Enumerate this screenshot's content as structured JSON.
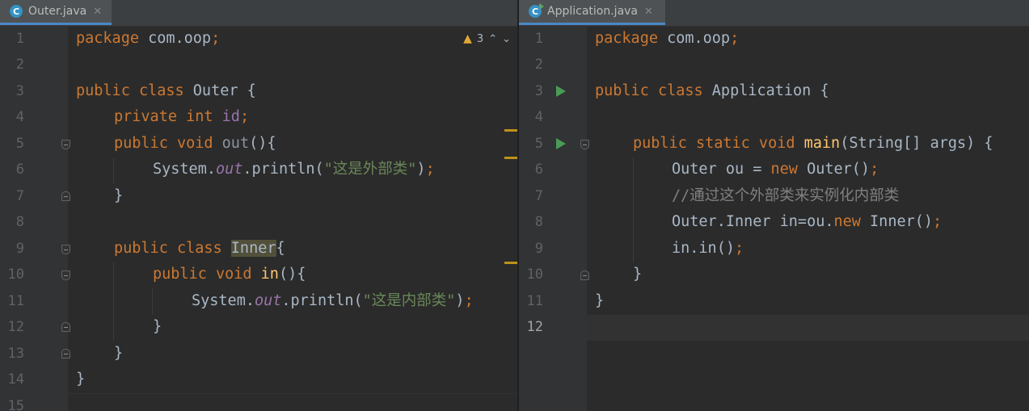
{
  "left_editor": {
    "tab": {
      "icon": "class-icon",
      "icon_letter": "C",
      "label": "Outer.java",
      "close": "✕"
    },
    "warnings": {
      "icon": "warning-icon",
      "count": "3",
      "prev": "⌃",
      "next": "⌄"
    },
    "line_numbers": [
      "1",
      "2",
      "3",
      "4",
      "5",
      "6",
      "7",
      "8",
      "9",
      "10",
      "11",
      "12",
      "13",
      "14",
      "15"
    ],
    "code": {
      "l1": {
        "kw": "package",
        "rest": " com.oop",
        "semi": ";"
      },
      "l3": {
        "kw": "public class",
        "rest": " Outer {"
      },
      "l4": {
        "kw": "private int",
        "field": "id",
        "semi": ";"
      },
      "l5": {
        "kw": "public void",
        "name": "out",
        "rest": "(){"
      },
      "l6": {
        "a": "System.",
        "it": "out",
        "b": ".println(",
        "str": "\"这是外部类\"",
        "c": ")",
        "semi": ";"
      },
      "l7": {
        "rest": "}"
      },
      "l9": {
        "kw": "public class",
        "name": "Inner",
        "rest": "{"
      },
      "l10": {
        "kw": "public void",
        "name": "in",
        "rest": "(){"
      },
      "l11": {
        "a": "System.",
        "it": "out",
        "b": ".println(",
        "str": "\"这是内部类\"",
        "c": ")",
        "semi": ";"
      },
      "l12": {
        "rest": "}"
      },
      "l13": {
        "rest": "}"
      },
      "l14": {
        "rest": "}"
      }
    }
  },
  "right_editor": {
    "tab": {
      "icon": "runnable-class-icon",
      "icon_letter": "C",
      "label": "Application.java",
      "close": "✕"
    },
    "line_numbers": [
      "1",
      "2",
      "3",
      "4",
      "5",
      "6",
      "7",
      "8",
      "9",
      "10",
      "11",
      "12"
    ],
    "code": {
      "l1": {
        "kw": "package",
        "rest": " com.oop",
        "semi": ";"
      },
      "l3": {
        "kw": "public class",
        "rest": " Application {"
      },
      "l5": {
        "kw": "public static void",
        "name": "main",
        "rest": "(String[] args) {"
      },
      "l6": {
        "a": "Outer ou = ",
        "kw": "new",
        "b": " Outer()",
        "semi": ";"
      },
      "l7": {
        "comment": "//通过这个外部类来实例化内部类"
      },
      "l8": {
        "a": "Outer.Inner in=ou.",
        "kw": "new",
        "b": " Inner()",
        "semi": ";"
      },
      "l9": {
        "a": "in.in()",
        "semi": ";"
      },
      "l10": {
        "rest": "}"
      },
      "l11": {
        "rest": "}"
      }
    }
  },
  "colors": {
    "keyword": "#cc7832",
    "field": "#9876aa",
    "method": "#ffc66d",
    "string": "#6a8759",
    "text": "#a9b7c6",
    "comment": "#808080",
    "run": "#499c54"
  }
}
